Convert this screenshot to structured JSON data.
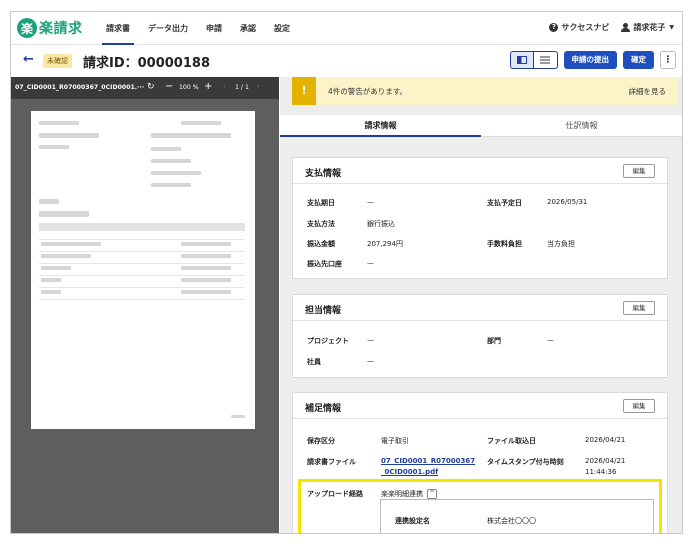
{
  "nav": {
    "logo_mark": "楽",
    "logo_text": "楽請求",
    "tabs": [
      "請求書",
      "データ出力",
      "申請",
      "承認",
      "設定"
    ],
    "success_navi": "サクセスナビ",
    "user_name": "請求花子"
  },
  "header": {
    "status_badge": "未確認",
    "title": "請求ID：00000188",
    "submit_label": "申請の提出",
    "confirm_label": "確定",
    "more_label": "⋮"
  },
  "viewer": {
    "file_name": "07_CID0001_R07000367_0CID0001.···",
    "zoom": "100 %",
    "page": "1 / 1"
  },
  "warning": {
    "text": "4件の警告があります。",
    "link": "詳細を見る"
  },
  "tabs": [
    "請求情報",
    "仕訳情報"
  ],
  "payment": {
    "title": "支払情報",
    "edit": "編集",
    "due_label": "支払期日",
    "due_value": "—",
    "scheduled_label": "支払予定日",
    "scheduled_value": "2026/05/31",
    "method_label": "支払方法",
    "method_value": "銀行振込",
    "amount_label": "振込金額",
    "amount_value": "207,294円",
    "fee_label": "手数料負担",
    "fee_value": "当方負担",
    "account_label": "振込先口座",
    "account_value": "—"
  },
  "owner": {
    "title": "担当情報",
    "edit": "編集",
    "project_label": "プロジェクト",
    "project_value": "—",
    "dept_label": "部門",
    "dept_value": "—",
    "staff_label": "社員",
    "staff_value": "—"
  },
  "supplement": {
    "title": "補足情報",
    "edit": "編集",
    "storage_label": "保存区分",
    "storage_value": "電子取引",
    "import_label": "ファイル取込日",
    "import_value": "2026/04/21",
    "file_label": "請求書ファイル",
    "file_value_1": "07_CID0001_R07000367",
    "file_value_2": "_0CID0001.pdf",
    "timestamp_label": "タイムスタンプ付与時刻",
    "timestamp_date": "2026/04/21",
    "timestamp_time": "11:44:36",
    "route_label": "アップロード経路",
    "route_value": "楽楽明細連携",
    "link_setting_label": "連携設定名",
    "link_setting_value": "株式会社〇〇〇"
  }
}
